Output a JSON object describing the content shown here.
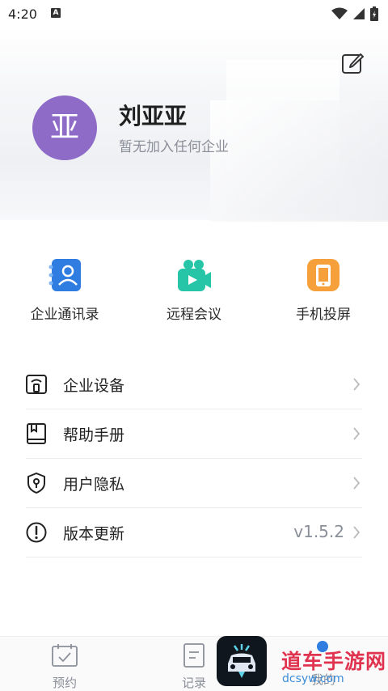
{
  "status": {
    "time": "4:20",
    "notif_glyph": "A"
  },
  "user": {
    "avatar_char": "亚",
    "name": "刘亚亚",
    "subtitle": "暂无加入任何企业"
  },
  "quick_actions": [
    {
      "label": "企业通讯录",
      "icon": "address-book-icon",
      "color": "#2f7de1"
    },
    {
      "label": "远程会议",
      "icon": "video-camera-icon",
      "color": "#27c5a8"
    },
    {
      "label": "手机投屏",
      "icon": "phone-cast-icon",
      "color": "#f5a03a"
    }
  ],
  "menu": [
    {
      "label": "企业设备",
      "icon": "device-icon",
      "value": ""
    },
    {
      "label": "帮助手册",
      "icon": "book-icon",
      "value": ""
    },
    {
      "label": "用户隐私",
      "icon": "shield-icon",
      "value": ""
    },
    {
      "label": "版本更新",
      "icon": "info-icon",
      "value": "v1.5.2"
    }
  ],
  "tabs": [
    {
      "label": "预约",
      "icon": "calendar-check-icon"
    },
    {
      "label": "记录",
      "icon": "record-icon"
    },
    {
      "label": "我的",
      "icon": "profile-icon"
    }
  ],
  "watermark": {
    "title": "道车手游网",
    "url": "dcsyw.com"
  }
}
